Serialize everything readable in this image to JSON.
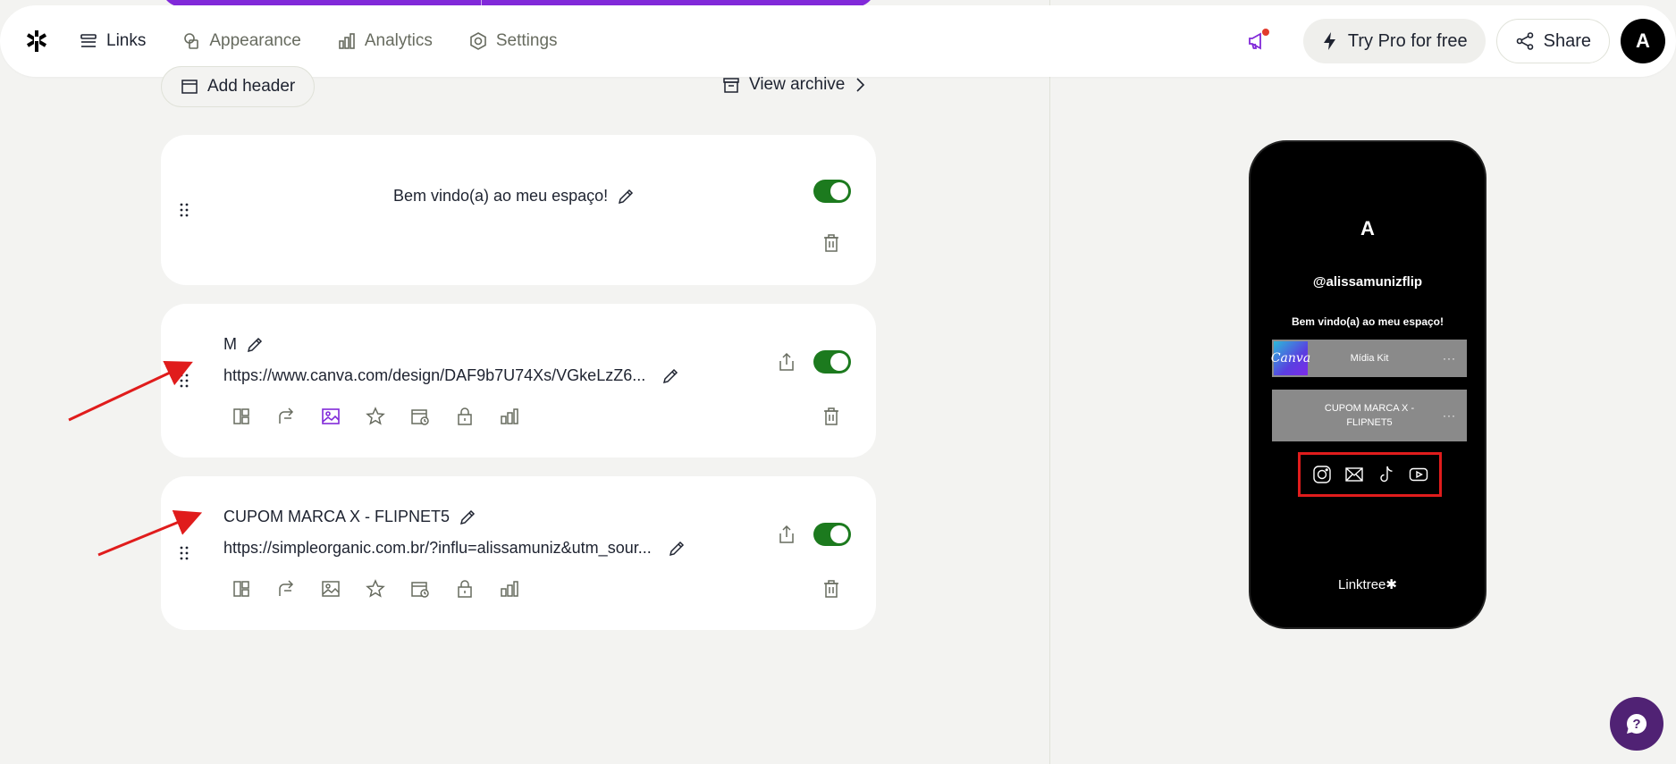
{
  "nav": {
    "links": "Links",
    "appearance": "Appearance",
    "analytics": "Analytics",
    "settings": "Settings",
    "try_pro": "Try Pro for free",
    "share": "Share",
    "avatar_initial": "A"
  },
  "toolbar": {
    "add_header": "Add header",
    "view_archive": "View archive"
  },
  "cards": [
    {
      "type": "header",
      "title": "Bem vindo(a) ao meu espaço!",
      "enabled": true
    },
    {
      "type": "link",
      "title": "M",
      "url": "https://www.canva.com/design/DAF9b7U74Xs/VGkeLzZ6...",
      "enabled": true,
      "active_tool": "thumbnail-icon"
    },
    {
      "type": "link",
      "title": "CUPOM MARCA X - FLIPNET5",
      "url": "https://simpleorganic.com.br/?influ=alissamuniz&utm_sour...",
      "enabled": true
    }
  ],
  "preview": {
    "avatar_initial": "A",
    "username": "@alissamunizflip",
    "bio": "Bem vindo(a) ao meu espaço!",
    "links": [
      {
        "label": "Mídia Kit",
        "thumbnail": "Canva"
      },
      {
        "label": "CUPOM MARCA X -\nFLIPNET5"
      }
    ],
    "socials": [
      "instagram-icon",
      "email-icon",
      "tiktok-icon",
      "youtube-icon"
    ],
    "brand": "Linktree✱"
  },
  "colors": {
    "accent_purple": "#8129d9",
    "toggle_green": "#1c7a1e",
    "annotation_red": "#e01c1c",
    "help_purple": "#502274"
  }
}
